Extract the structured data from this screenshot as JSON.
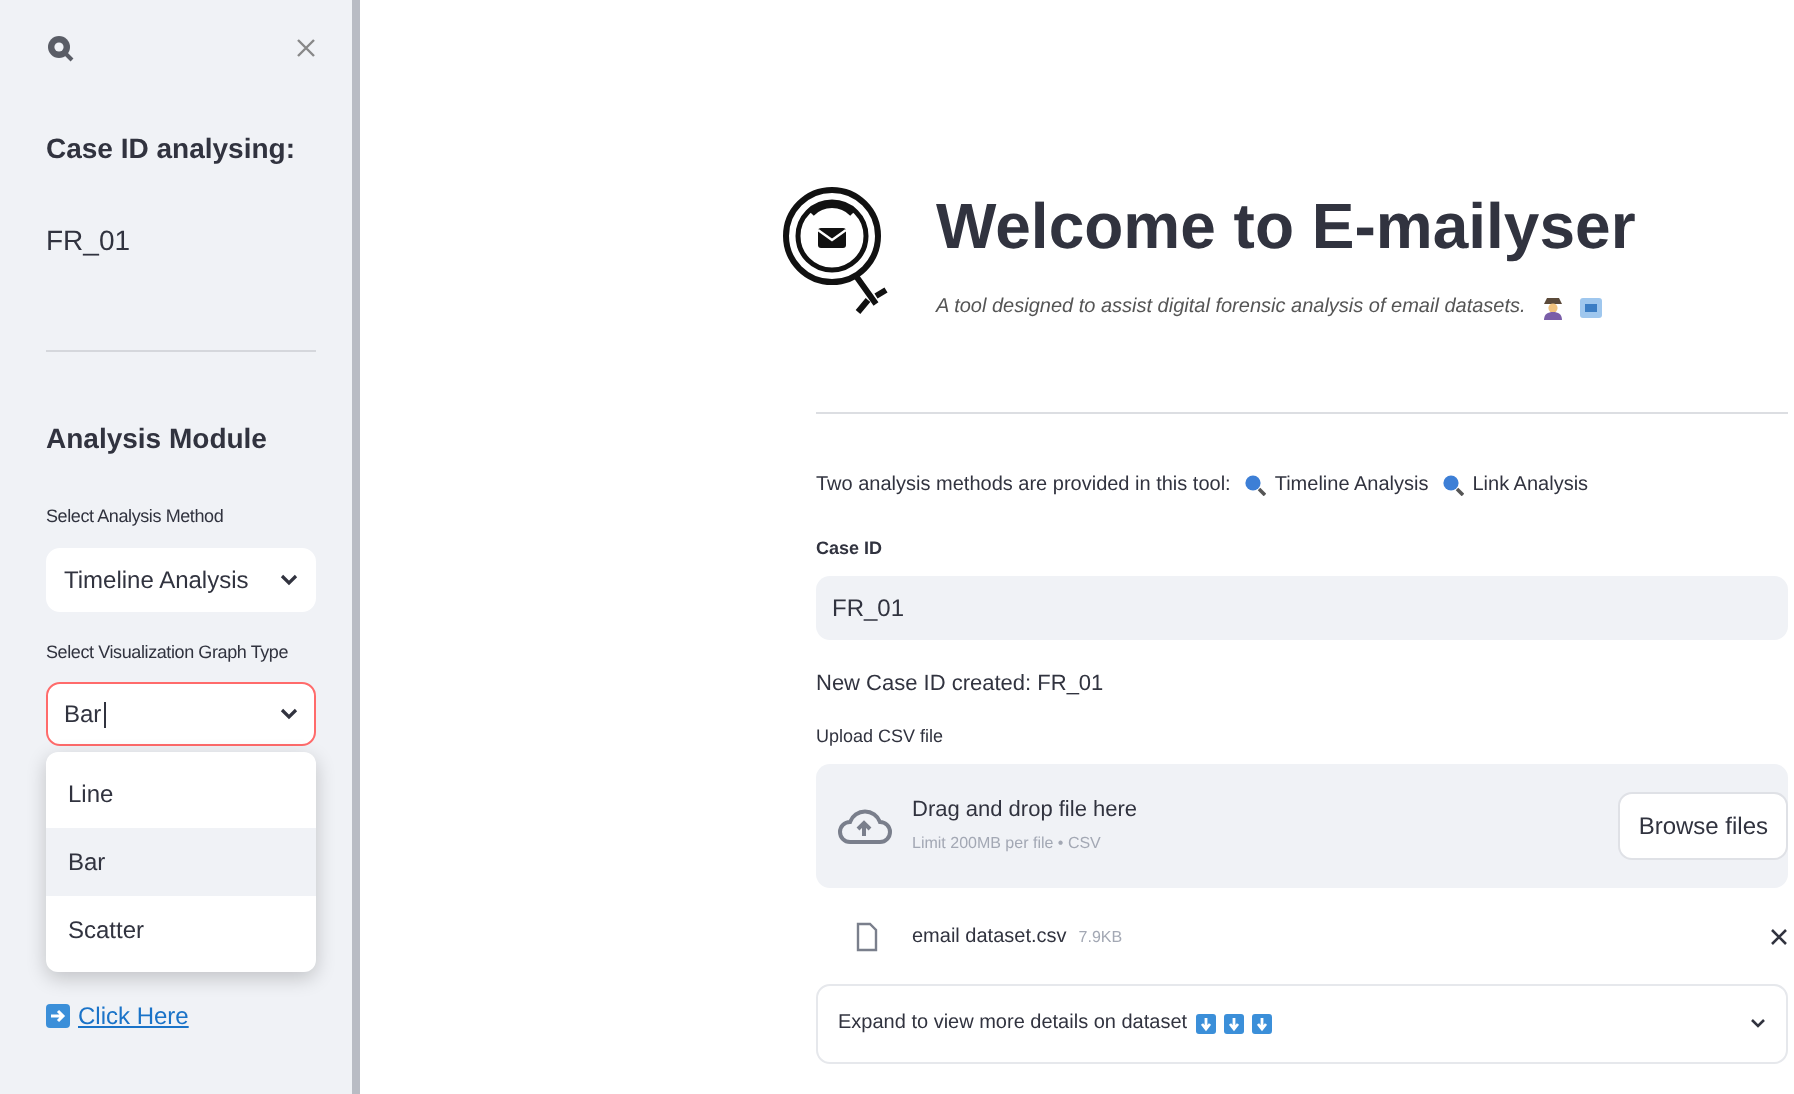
{
  "sidebar": {
    "case_heading": "Case ID analysing:",
    "case_id": "FR_01",
    "module_heading": "Analysis Module",
    "method_select": {
      "label": "Select Analysis Method",
      "value": "Timeline Analysis"
    },
    "graph_select": {
      "label": "Select Visualization Graph Type",
      "value": "Bar",
      "focused": true,
      "options": [
        {
          "label": "Line",
          "selected": false
        },
        {
          "label": "Bar",
          "selected": true
        },
        {
          "label": "Scatter",
          "selected": false
        }
      ]
    },
    "link": "Click Here"
  },
  "main": {
    "title": "Welcome to E-mailyser",
    "subtitle": "A tool designed to assist digital forensic analysis of email datasets.",
    "intro": "Two analysis methods are provided in this tool:",
    "methods": [
      "Timeline Analysis",
      "Link Analysis"
    ],
    "case_id_label": "Case ID",
    "case_id_value": "FR_01",
    "created_message": "New Case ID created: FR_01",
    "upload_label": "Upload CSV file",
    "dropzone_title": "Drag and drop file here",
    "dropzone_limit": "Limit 200MB per file • CSV",
    "browse_button": "Browse files",
    "file": {
      "name": "email dataset.csv",
      "size": "7.9KB"
    },
    "expander": {
      "label": "Expand to view more details on dataset",
      "badges": [
        {
          "kind": "down-arrow"
        },
        {
          "kind": "down-arrow"
        },
        {
          "kind": "down-arrow"
        }
      ]
    }
  }
}
